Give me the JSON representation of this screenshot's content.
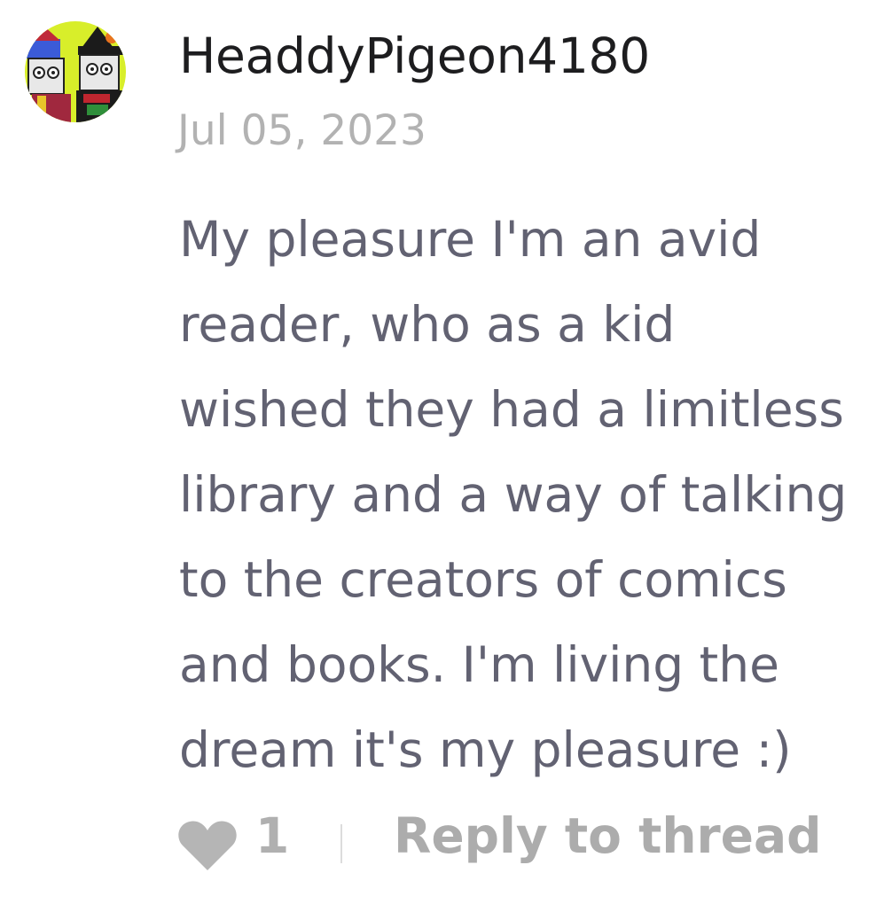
{
  "comment": {
    "author": "HeaddyPigeon4180",
    "date": "Jul 05, 2023",
    "body_lines": [
      "My pleasure I'm an avid",
      "reader, who as a kid",
      "wished they had a limitless",
      "library and a way of talking",
      "to the creators of comics",
      "and books. I'm living the",
      "dream it's my pleasure :)"
    ],
    "like_count": "1",
    "reply_label": "Reply to thread",
    "avatar_icon": "user-avatar-icon",
    "like_icon": "heart-icon"
  },
  "colors": {
    "author": "#1d1d1f",
    "date": "#b2b2b2",
    "body": "#626272",
    "actions": "#acacac"
  }
}
